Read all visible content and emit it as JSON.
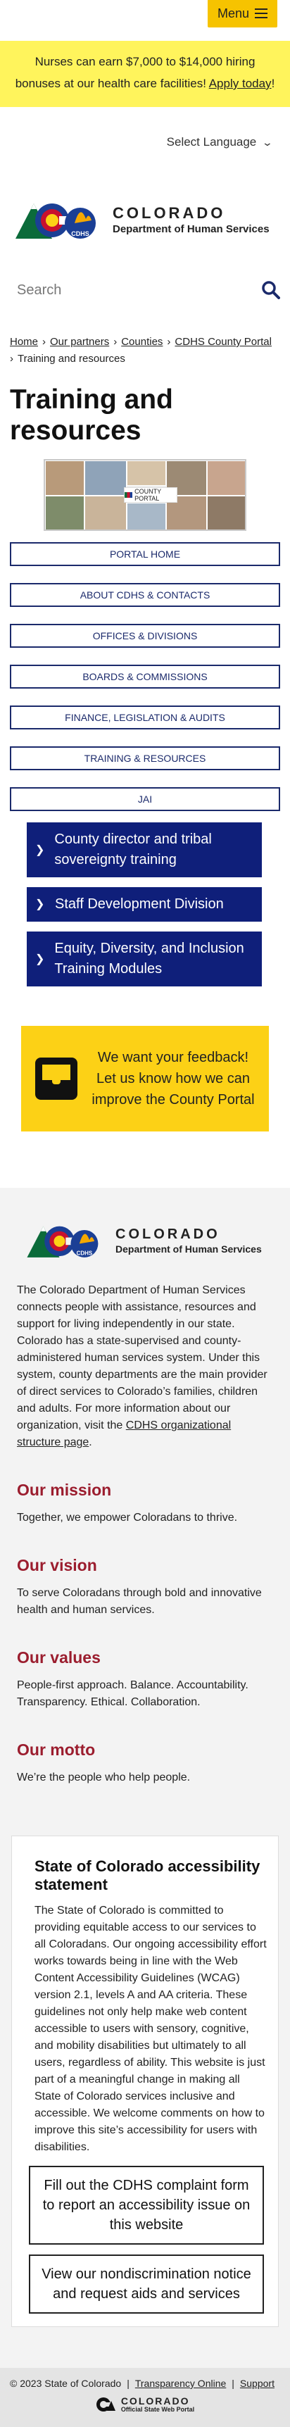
{
  "header": {
    "menu_label": "Menu"
  },
  "banner": {
    "text": "Nurses can earn $7,000 to $14,000 hiring bonuses at our health care facilities!",
    "link_text": "Apply today",
    "suffix": "!"
  },
  "language": {
    "selected": "Select Language"
  },
  "logo": {
    "word1": "COLORADO",
    "word2": "Department of Human Services",
    "badge": "CDHS"
  },
  "search": {
    "placeholder": "Search"
  },
  "breadcrumb": {
    "items": [
      "Home",
      "Our partners",
      "Counties",
      "CDHS County Portal"
    ],
    "current": "Training and resources"
  },
  "page": {
    "title": "Training and resources"
  },
  "hero": {
    "badge_text": "COUNTY PORTAL"
  },
  "nav": {
    "items": [
      "PORTAL HOME",
      "ABOUT CDHS & CONTACTS",
      "OFFICES & DIVISIONS",
      "BOARDS & COMMISSIONS",
      "FINANCE, LEGISLATION & AUDITS",
      "TRAINING & RESOURCES",
      "JAI"
    ]
  },
  "accordion": {
    "items": [
      "County director and tribal sovereignty training",
      "Staff Development Division",
      "Equity, Diversity, and Inclusion Training Modules"
    ]
  },
  "feedback": {
    "text": "We want your feedback! Let us know how we can improve the County Portal"
  },
  "footer": {
    "about": "The Colorado Department of Human Services connects people with assistance, resources and support for living independently in our state. Colorado has a state-supervised and county-administered human services system. Under this system, county departments are the main provider of direct services to Colorado’s families, children and adults. For more information about our organization, visit the",
    "about_link": "CDHS organizational structure page",
    "about_end": ".",
    "mission_title": "Our mission",
    "mission": "Together, we empower Coloradans to thrive.",
    "vision_title": "Our vision",
    "vision": "To serve Coloradans through bold and innovative health and human services.",
    "values_title": "Our values",
    "values": "People-first approach. Balance. Accountability. Transparency. Ethical. Collaboration.",
    "motto_title": "Our motto",
    "motto": "We’re the people who help people."
  },
  "accessibility": {
    "title": "State of Colorado accessibility statement",
    "body": "The State of Colorado is committed to providing equitable access to our services to all Coloradans. Our ongoing accessibility effort works towards being in line with the Web Content Accessibility Guidelines (WCAG) version 2.1, levels A and AA criteria. These guidelines not only help make web content accessible to users with sensory, cognitive, and mobility disabilities but ultimately to all users, regardless of ability. This website is just part of a meaningful change in making all State of Colorado services inclusive and accessible. We welcome comments on how to improve this site’s accessibility for users with disabilities.",
    "cta1": "Fill out the CDHS complaint form to report an accessibility issue on this website",
    "cta2": "View our nondiscrimination notice and request aids and services"
  },
  "legal": {
    "copyright": "© 2023 State of Colorado",
    "link1": "Transparency Online",
    "link2": "Support"
  },
  "official": {
    "word": "COLORADO",
    "sub": "Official State Web Portal"
  },
  "colors": {
    "banner_bg": "#fff45c",
    "accent_yellow": "#fcd116",
    "navy": "#0f1f7a",
    "heading_red": "#9b1d2e"
  }
}
